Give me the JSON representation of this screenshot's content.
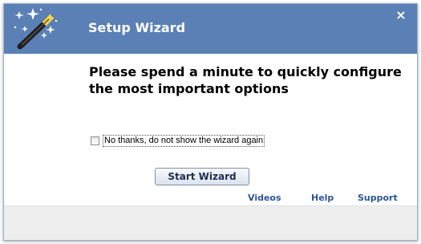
{
  "window": {
    "title": "Setup Wizard",
    "close_glyph": "×",
    "icon": "magic-wand-icon",
    "titlebar_color": "#5b80b6"
  },
  "content": {
    "headline": "Please spend a minute to quickly configure the most important options",
    "dont_show_checkbox": {
      "label": "No thanks, do not show the wizard again",
      "checked": false
    },
    "start_button_label": "Start Wizard"
  },
  "links": {
    "videos": "Videos",
    "help": "Help",
    "support": "Support",
    "color": "#2d5595"
  }
}
